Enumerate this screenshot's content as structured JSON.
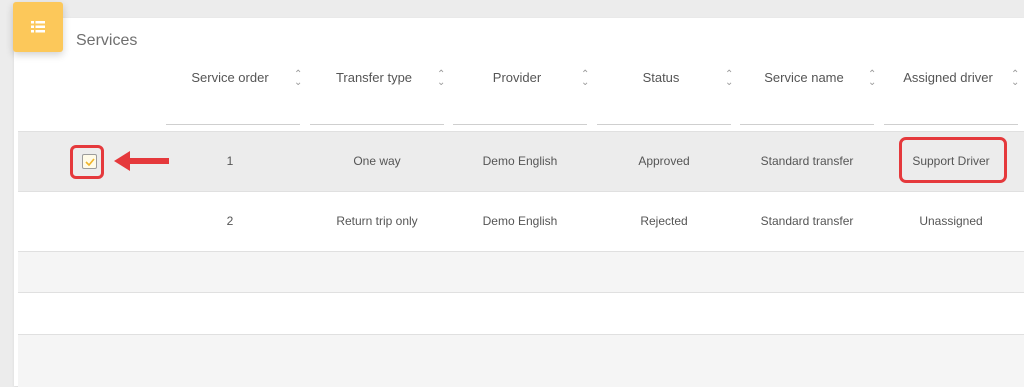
{
  "panel": {
    "title": "Services",
    "header_icon": "list-icon",
    "accent_color": "#fcc85a"
  },
  "table": {
    "columns": [
      {
        "key": "service_order",
        "label": "Service order"
      },
      {
        "key": "transfer_type",
        "label": "Transfer type"
      },
      {
        "key": "provider",
        "label": "Provider"
      },
      {
        "key": "status",
        "label": "Status"
      },
      {
        "key": "service_name",
        "label": "Service name"
      },
      {
        "key": "assigned_driver",
        "label": "Assigned driver"
      }
    ],
    "sort_icon": "sort-updown-icon",
    "rows": [
      {
        "checked": true,
        "service_order": "1",
        "transfer_type": "One way",
        "provider": "Demo English",
        "status": "Approved",
        "service_name": "Standard transfer",
        "assigned_driver": "Support Driver"
      },
      {
        "checked": false,
        "service_order": "2",
        "transfer_type": "Return trip only",
        "provider": "Demo English",
        "status": "Rejected",
        "service_name": "Standard transfer",
        "assigned_driver": "Unassigned"
      }
    ]
  },
  "annotations": {
    "highlight_color": "#e5393c",
    "arrow_icon": "arrow-left-icon"
  }
}
